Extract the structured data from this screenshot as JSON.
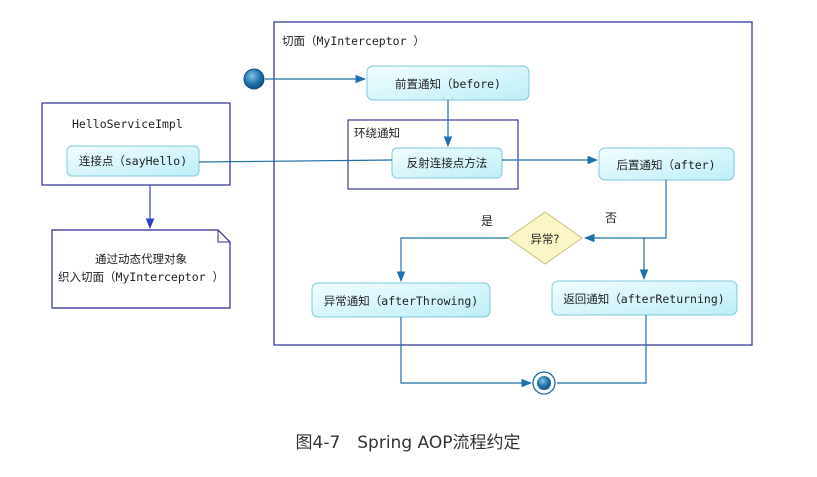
{
  "aspect": {
    "title": "切面（MyInterceptor ）"
  },
  "target": {
    "title": "HelloServiceImpl",
    "joinpoint": "连接点（sayHello)"
  },
  "note": {
    "line1": "通过动态代理对象",
    "line2": "织入切面（MyInterceptor ）"
  },
  "nodes": {
    "before": "前置通知（before)",
    "around": "环绕通知",
    "reflect": "反射连接点方法",
    "after": "后置通知（after)",
    "decision": "异常?",
    "yes": "是",
    "no": "否",
    "throwing": "异常通知（afterThrowing)",
    "returning": "返回通知（afterReturning)"
  },
  "caption": "图4-7　Spring AOP流程约定",
  "colors": {
    "frame": "#2b2b8f",
    "arrow": "#1f6fa8",
    "node_fill": "#d6f6fb",
    "node_border": "#7fc9db",
    "decision_fill": "#fbf6c8",
    "decision_border": "#c9c07a",
    "start_node": "#1f6fa8"
  }
}
